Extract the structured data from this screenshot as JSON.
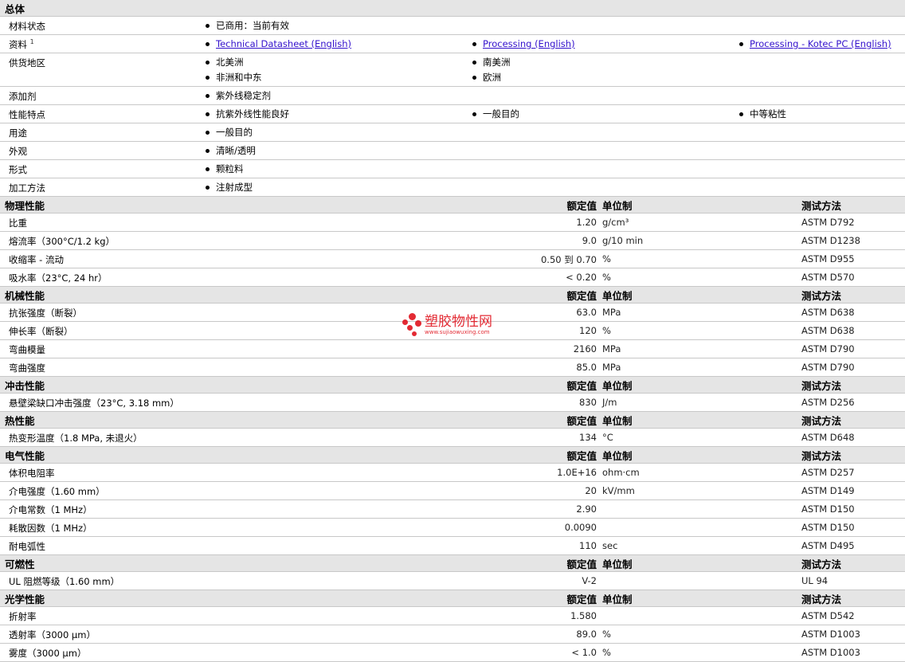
{
  "general": {
    "title": "总体",
    "rows": [
      {
        "label": "材料状态",
        "items": [
          "已商用：当前有效"
        ]
      },
      {
        "label": "资料",
        "sup": "1",
        "links": [
          "Technical Datasheet (English)",
          "Processing (English)",
          "Processing - Kotec PC (English)"
        ]
      },
      {
        "label": "供货地区",
        "items": [
          "北美洲",
          "南美洲",
          "非洲和中东",
          "欧洲"
        ]
      },
      {
        "label": "添加剂",
        "items": [
          "紫外线稳定剂"
        ]
      },
      {
        "label": "性能特点",
        "items": [
          "抗紫外线性能良好",
          "一般目的",
          "中等粘性"
        ]
      },
      {
        "label": "用途",
        "items": [
          "一般目的"
        ]
      },
      {
        "label": "外观",
        "items": [
          "清晰/透明"
        ]
      },
      {
        "label": "形式",
        "items": [
          "颗粒料"
        ]
      },
      {
        "label": "加工方法",
        "items": [
          "注射成型"
        ]
      }
    ]
  },
  "headers": {
    "value": "额定值",
    "unit": "单位制",
    "method": "测试方法"
  },
  "sections": [
    {
      "title": "物理性能",
      "rows": [
        {
          "label": "比重",
          "value": "1.20",
          "unit": "g/cm³",
          "method": "ASTM D792"
        },
        {
          "label": "熔流率（300°C/1.2 kg）",
          "value": "9.0",
          "unit": "g/10 min",
          "method": "ASTM D1238"
        },
        {
          "label": "收缩率 - 流动",
          "value": "0.50 到  0.70",
          "unit": "%",
          "method": "ASTM D955"
        },
        {
          "label": "吸水率（23°C, 24 hr）",
          "value": "< 0.20",
          "unit": "%",
          "method": "ASTM D570"
        }
      ]
    },
    {
      "title": "机械性能",
      "rows": [
        {
          "label": "抗张强度（断裂）",
          "value": "63.0",
          "unit": "MPa",
          "method": "ASTM D638"
        },
        {
          "label": "伸长率（断裂）",
          "value": "120",
          "unit": "%",
          "method": "ASTM D638"
        },
        {
          "label": "弯曲模量",
          "value": "2160",
          "unit": "MPa",
          "method": "ASTM D790"
        },
        {
          "label": "弯曲强度",
          "value": "85.0",
          "unit": "MPa",
          "method": "ASTM D790"
        }
      ]
    },
    {
      "title": "冲击性能",
      "rows": [
        {
          "label": "悬壁梁缺口冲击强度（23°C, 3.18 mm）",
          "value": "830",
          "unit": "J/m",
          "method": "ASTM D256"
        }
      ]
    },
    {
      "title": "热性能",
      "rows": [
        {
          "label": "热变形温度（1.8 MPa, 未退火）",
          "value": "134",
          "unit": "°C",
          "method": "ASTM D648"
        }
      ]
    },
    {
      "title": "电气性能",
      "rows": [
        {
          "label": "体积电阻率",
          "value": "1.0E+16",
          "unit": "ohm·cm",
          "method": "ASTM D257"
        },
        {
          "label": "介电强度（1.60 mm）",
          "value": "20",
          "unit": "kV/mm",
          "method": "ASTM D149"
        },
        {
          "label": "介电常数（1 MHz）",
          "value": "2.90",
          "unit": "",
          "method": "ASTM D150"
        },
        {
          "label": "耗散因数（1 MHz）",
          "value": "0.0090",
          "unit": "",
          "method": "ASTM D150"
        },
        {
          "label": "耐电弧性",
          "value": "110",
          "unit": "sec",
          "method": "ASTM D495"
        }
      ]
    },
    {
      "title": "可燃性",
      "rows": [
        {
          "label": "UL 阻燃等级（1.60 mm）",
          "value": "V-2",
          "unit": "",
          "method": "UL 94"
        }
      ]
    },
    {
      "title": "光学性能",
      "rows": [
        {
          "label": "折射率",
          "value": "1.580",
          "unit": "",
          "method": "ASTM D542"
        },
        {
          "label": "透射率（3000 µm）",
          "value": "89.0",
          "unit": "%",
          "method": "ASTM D1003"
        },
        {
          "label": "雾度（3000 µm）",
          "value": "< 1.0",
          "unit": "%",
          "method": "ASTM D1003"
        }
      ]
    }
  ],
  "watermark": {
    "text": "塑胶物性网",
    "url": "www.sujiaowuxing.com"
  }
}
